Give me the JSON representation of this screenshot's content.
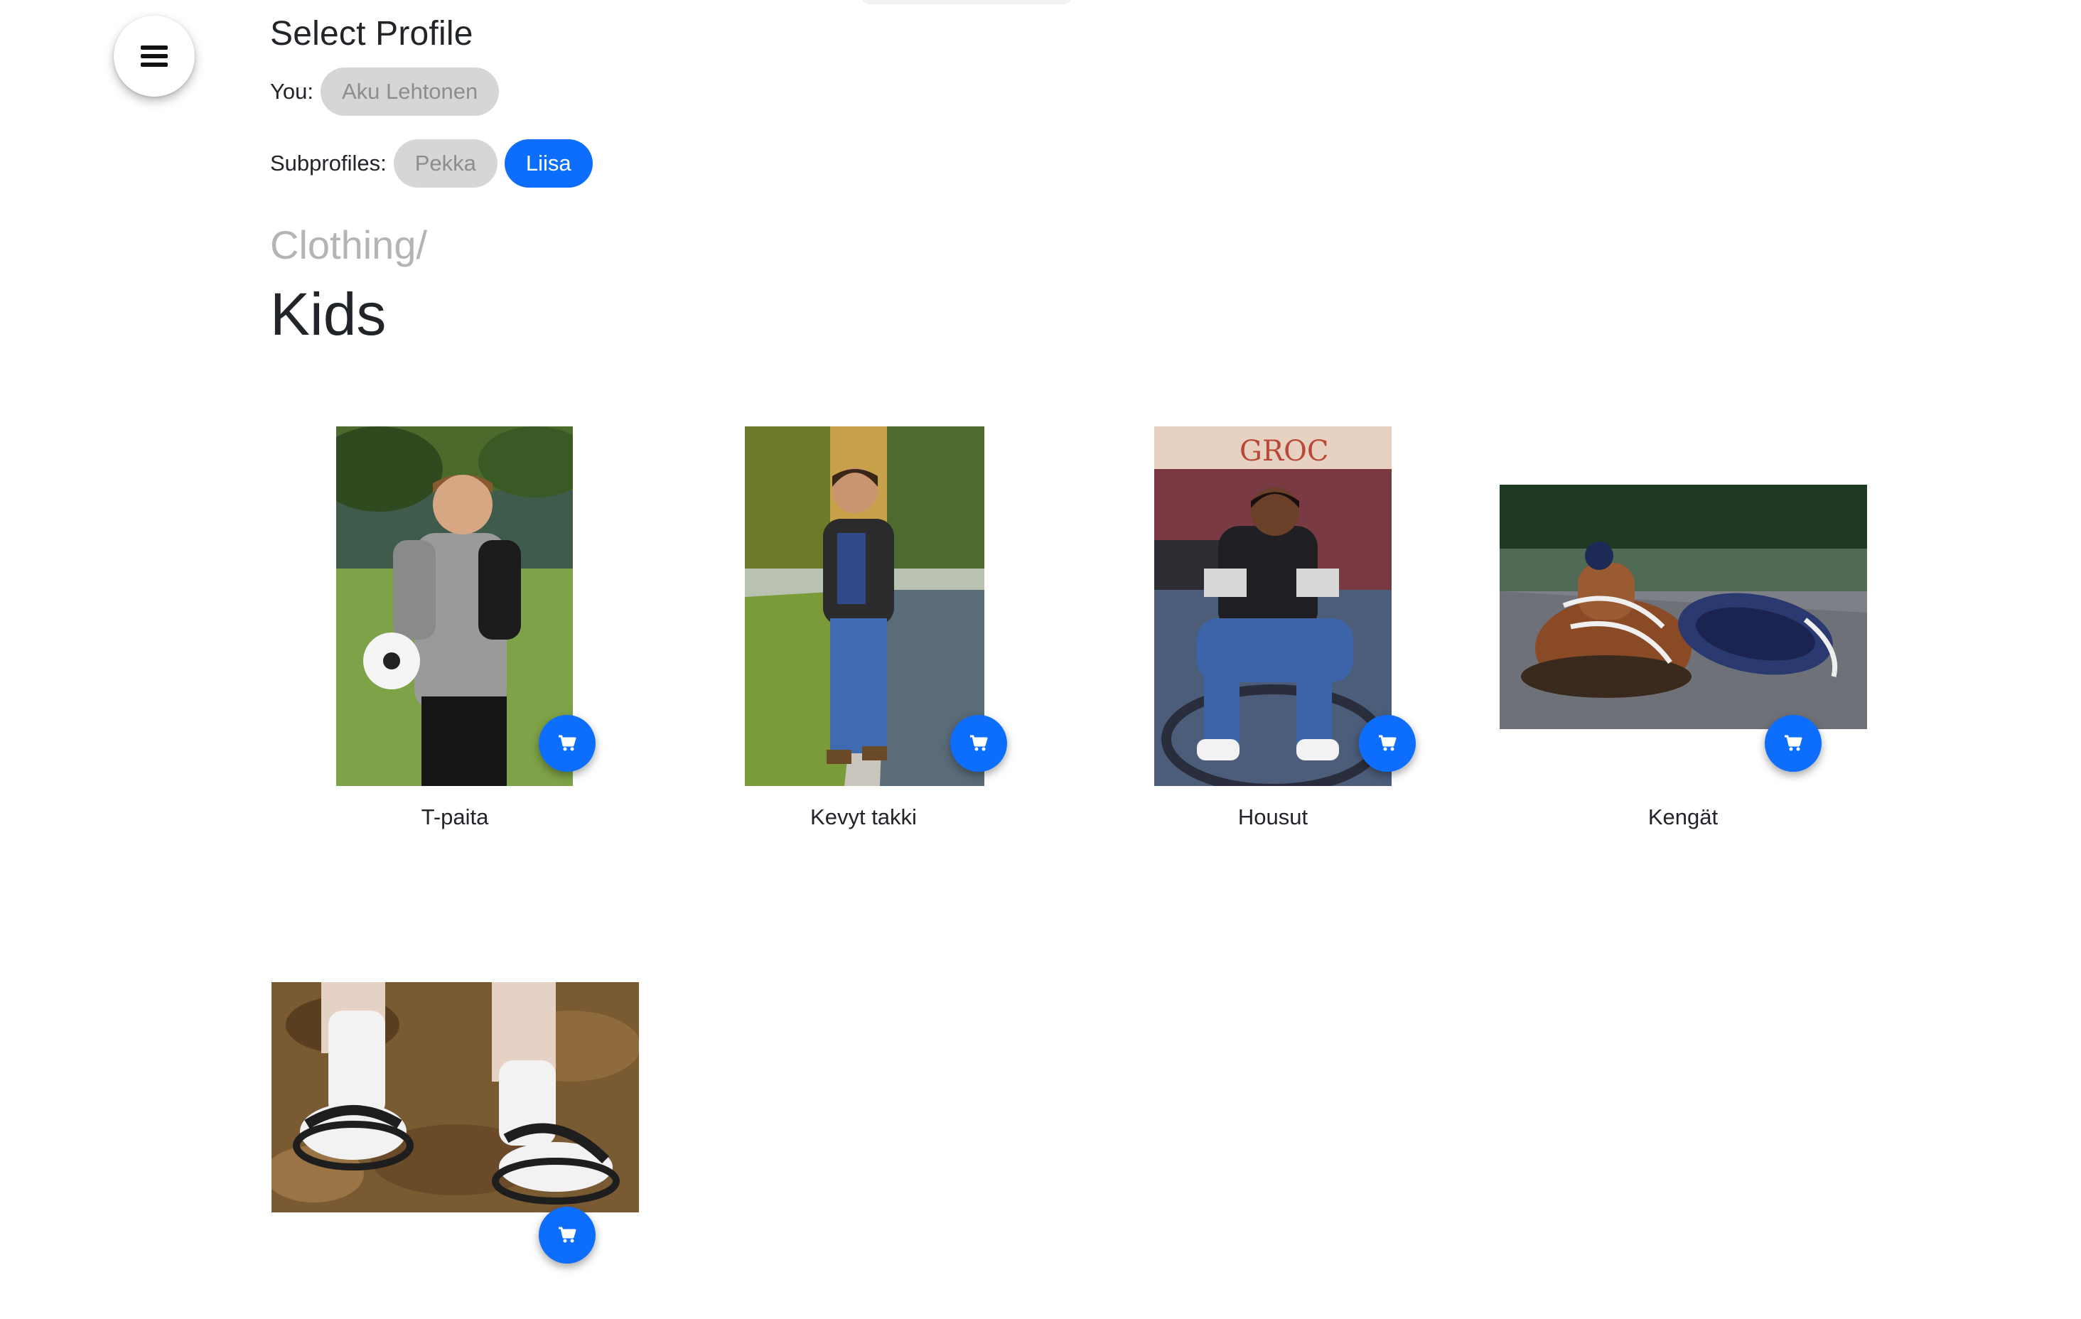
{
  "profile": {
    "title": "Select Profile",
    "you_label": "You:",
    "you_name": "Aku Lehtonen",
    "subprofiles_label": "Subprofiles:",
    "subprofiles": [
      {
        "name": "Pekka",
        "selected": false
      },
      {
        "name": "Liisa",
        "selected": true
      }
    ]
  },
  "category": {
    "breadcrumb": "Clothing/",
    "title": "Kids"
  },
  "products": [
    {
      "name": "T-paita",
      "image": "boy-with-soccer-ball-photo"
    },
    {
      "name": "Kevyt takki",
      "image": "boy-in-jacket-by-pond-photo"
    },
    {
      "name": "Housut",
      "image": "boy-sitting-on-railing-photo"
    },
    {
      "name": "Kengät",
      "image": "worn-sneakers-on-pavement-photo"
    },
    {
      "name": "",
      "image": "sandals-with-white-socks-photo"
    }
  ],
  "icons": {
    "menu": "menu-icon",
    "cart": "cart-icon"
  },
  "colors": {
    "accent": "#0d6efd",
    "chip_inactive_bg": "#d6d6d6",
    "chip_inactive_text": "#8d8d8d",
    "breadcrumb": "#b4b4b4"
  }
}
